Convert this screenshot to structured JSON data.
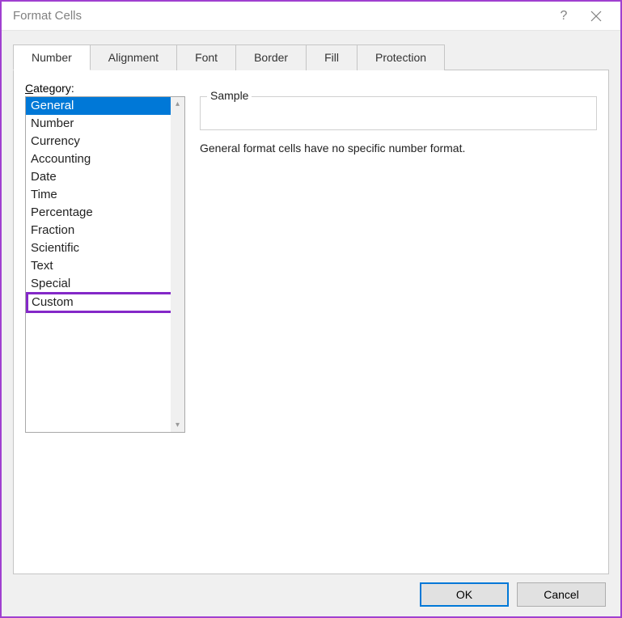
{
  "window": {
    "title": "Format Cells",
    "help_glyph": "?",
    "close_label": "Close"
  },
  "tabs": [
    {
      "label": "Number",
      "active": true
    },
    {
      "label": "Alignment",
      "active": false
    },
    {
      "label": "Font",
      "active": false
    },
    {
      "label": "Border",
      "active": false
    },
    {
      "label": "Fill",
      "active": false
    },
    {
      "label": "Protection",
      "active": false
    }
  ],
  "category": {
    "label_pre": "C",
    "label_rest": "ategory:",
    "items": [
      {
        "label": "General",
        "selected": true,
        "highlighted": false
      },
      {
        "label": "Number",
        "selected": false,
        "highlighted": false
      },
      {
        "label": "Currency",
        "selected": false,
        "highlighted": false
      },
      {
        "label": "Accounting",
        "selected": false,
        "highlighted": false
      },
      {
        "label": "Date",
        "selected": false,
        "highlighted": false
      },
      {
        "label": "Time",
        "selected": false,
        "highlighted": false
      },
      {
        "label": "Percentage",
        "selected": false,
        "highlighted": false
      },
      {
        "label": "Fraction",
        "selected": false,
        "highlighted": false
      },
      {
        "label": "Scientific",
        "selected": false,
        "highlighted": false
      },
      {
        "label": "Text",
        "selected": false,
        "highlighted": false
      },
      {
        "label": "Special",
        "selected": false,
        "highlighted": false
      },
      {
        "label": "Custom",
        "selected": false,
        "highlighted": true
      }
    ]
  },
  "sample": {
    "legend": "Sample",
    "value": ""
  },
  "description": "General format cells have no specific number format.",
  "buttons": {
    "ok": "OK",
    "cancel": "Cancel"
  }
}
